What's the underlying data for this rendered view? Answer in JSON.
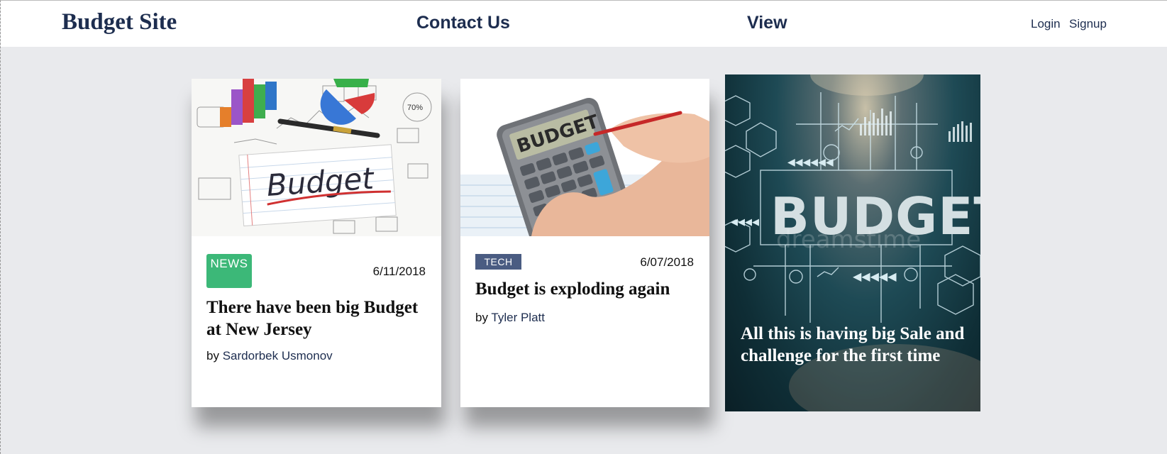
{
  "nav": {
    "brand": "Budget Site",
    "links": [
      "Contact Us",
      "View"
    ],
    "login": "Login",
    "signup": "Signup"
  },
  "cards": [
    {
      "badge": "NEWS",
      "date": "6/11/2018",
      "title": "There have been big Budget at New Jersey",
      "author_prefix": "by",
      "author": "Sardorbek Usmonov",
      "image_text": "Budget",
      "image_icon": "budget-charts-illustration"
    },
    {
      "badge": "TECH",
      "date": "6/07/2018",
      "title": "Budget is exploding again",
      "author_prefix": "by",
      "author": "Tyler Platt",
      "image_text": "BUDGET",
      "image_icon": "calculator-photo"
    }
  ],
  "feature": {
    "title": "All this is having big Sale and challenge for the first time",
    "image_text": "BUDGET",
    "watermark": "dreamstime",
    "image_icon": "budget-infographic-background"
  },
  "colors": {
    "brand": "#1d2d4f",
    "news_badge": "#3cb878",
    "tech_badge": "#4a5c82",
    "background": "#e9eaed"
  }
}
